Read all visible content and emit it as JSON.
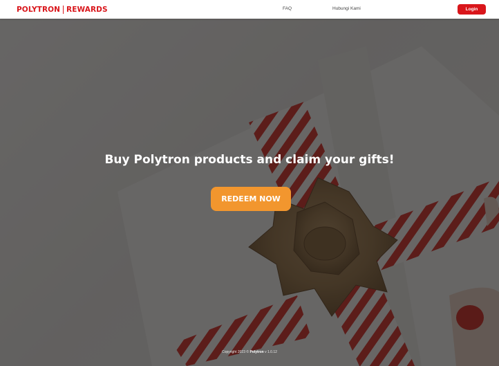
{
  "header": {
    "logo_brand": "POLYTRON",
    "logo_sub": "REWARDS",
    "nav": [
      {
        "label": "FAQ"
      },
      {
        "label": "Hubungi Kami"
      }
    ],
    "login_label": "Login"
  },
  "hero": {
    "headline": "Buy Polytron products and claim your gifts!",
    "cta_label": "REDEEM NOW",
    "background_image": "gift-box-with-red-white-ribbon-and-twine-bow"
  },
  "footer": {
    "copyright_prefix": "Copyright 2023 ©",
    "brand": "Polytron",
    "version": "v 1.0.12"
  },
  "colors": {
    "brand_red": "#d9161b",
    "cta_orange": "#f2962e",
    "overlay": "rgba(10,10,10,0.6)"
  }
}
